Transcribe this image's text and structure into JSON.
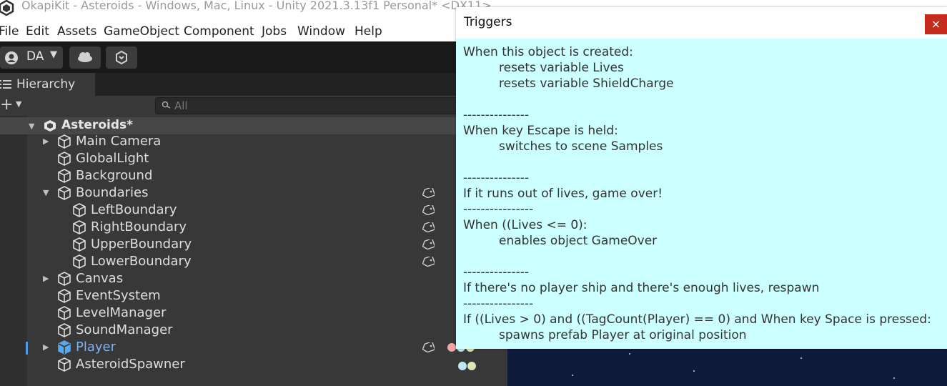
{
  "window": {
    "title": "OkapiKit - Asteroids - Windows, Mac, Linux - Unity 2021.3.13f1 Personal* <DX11>"
  },
  "menu": [
    "File",
    "Edit",
    "Assets",
    "GameObject",
    "Component",
    "Jobs",
    "Window",
    "Help"
  ],
  "toolbar": {
    "account_label": "DA"
  },
  "hierarchy": {
    "tab_label": "Hierarchy",
    "search_placeholder": "All",
    "scene_name": "Asteroids*",
    "items": [
      {
        "label": "Main Camera"
      },
      {
        "label": "GlobalLight"
      },
      {
        "label": "Background"
      },
      {
        "label": "Boundaries"
      },
      {
        "label": "LeftBoundary"
      },
      {
        "label": "RightBoundary"
      },
      {
        "label": "UpperBoundary"
      },
      {
        "label": "LowerBoundary"
      },
      {
        "label": "Canvas"
      },
      {
        "label": "EventSystem"
      },
      {
        "label": "LevelManager"
      },
      {
        "label": "SoundManager"
      },
      {
        "label": "Player"
      },
      {
        "label": "AsteroidSpawner"
      }
    ]
  },
  "triggers_popup": {
    "title": "Triggers",
    "close_label": "×",
    "lines": [
      "When this object is created:",
      "resets variable Lives",
      "resets variable ShieldCharge",
      "---------------",
      "When key Escape is held:",
      "switches to scene Samples",
      "---------------",
      "If it runs out of lives, game over!",
      "----------------",
      "When ((Lives <= 0):",
      "enables object GameOver",
      "---------------",
      "If there's no player ship and there's enough lives, respawn",
      "----------------",
      "If ((Lives > 0) and ((TagCount(Player) == 0) and When key Space is pressed:",
      "spawns prefab Player at original position"
    ]
  },
  "colors": {
    "popup_bg": "#ccffff",
    "selected_text": "#7db3f2",
    "close_button": "#c42b1c"
  }
}
